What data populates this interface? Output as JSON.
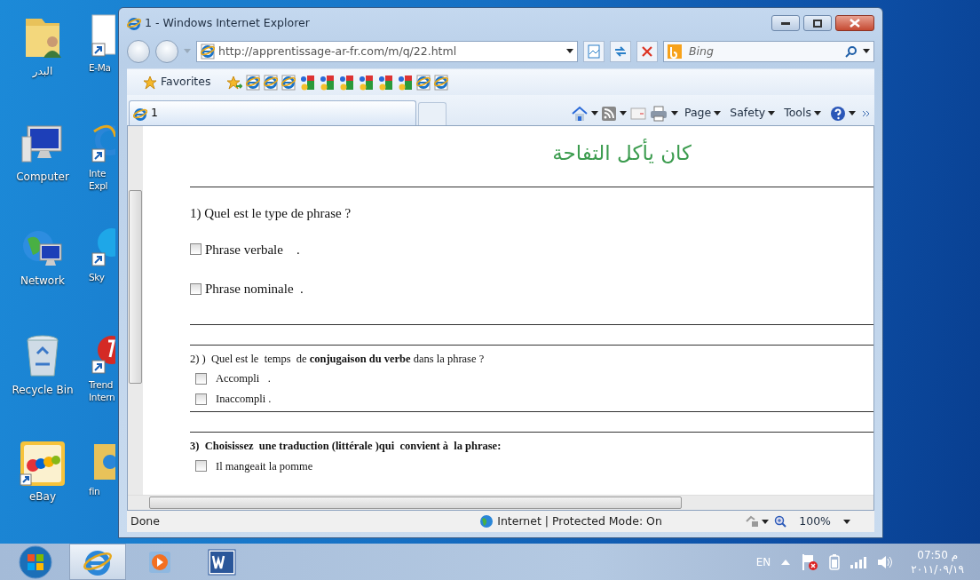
{
  "desktop_icons": [
    {
      "label": "البدر",
      "kind": "user-folder"
    },
    {
      "label": "Computer",
      "kind": "computer"
    },
    {
      "label": "Network",
      "kind": "network"
    },
    {
      "label": "Recycle Bin",
      "kind": "recycle"
    },
    {
      "label": "eBay",
      "kind": "ebay"
    },
    {
      "label": "E-Ma",
      "kind": "document"
    },
    {
      "label": "Inte Expl",
      "kind": "ie"
    },
    {
      "label": "Sky",
      "kind": "skype"
    },
    {
      "label": "Trend Intern",
      "kind": "trend"
    },
    {
      "label": "fin",
      "kind": "folder"
    }
  ],
  "window": {
    "title": "1 - Windows Internet Explorer"
  },
  "address_bar": {
    "url": "http://apprentissage-ar-fr.com/m/q/22.html"
  },
  "search": {
    "placeholder": "Bing"
  },
  "favorites": {
    "label": "Favorites",
    "links": [
      {
        "kind": "add"
      },
      {
        "kind": "page"
      },
      {
        "kind": "page"
      },
      {
        "kind": "page"
      },
      {
        "kind": "google"
      },
      {
        "kind": "google"
      },
      {
        "kind": "google"
      },
      {
        "kind": "google"
      },
      {
        "kind": "google"
      },
      {
        "kind": "google"
      },
      {
        "kind": "page"
      },
      {
        "kind": "page"
      }
    ]
  },
  "tabs": [
    {
      "label": "1",
      "selected": true
    }
  ],
  "command_bar": [
    "Page",
    "Safety",
    "Tools"
  ],
  "page": {
    "heading": "كان يأكل التفاحة",
    "questions": [
      {
        "kind": "spaced",
        "prompt": "1) Quel est le type de phrase ?",
        "options": [
          {
            "label": "Phrase verbale    .",
            "checked": false
          },
          {
            "label": "Phrase nominale  .",
            "checked": false
          }
        ]
      },
      {
        "kind": "compact",
        "prompt": "2) )  Quel est le  temps  de **conjugaison du verbe** dans la phrase ?",
        "options": [
          {
            "label": "Accompli   .",
            "checked": false
          },
          {
            "label": "Inaccompli .",
            "checked": false
          }
        ]
      },
      {
        "kind": "instruction",
        "prompt": "3)  Choisissez  une traduction (littérale )qui  convient à  la phrase:",
        "options": [
          {
            "label": "Il mangeait la pomme",
            "checked": false
          }
        ]
      }
    ]
  },
  "status_bar": {
    "text": "Done",
    "zone": "Internet | Protected Mode: On",
    "zoom": "100%"
  },
  "taskbar": {
    "buttons": [
      {
        "kind": "ie",
        "selected": true
      },
      {
        "kind": "media",
        "selected": false
      },
      {
        "kind": "word",
        "selected": false
      }
    ],
    "language": "EN",
    "time": "07:50 م",
    "date": "٢٠١١/٠٩/١٩"
  }
}
